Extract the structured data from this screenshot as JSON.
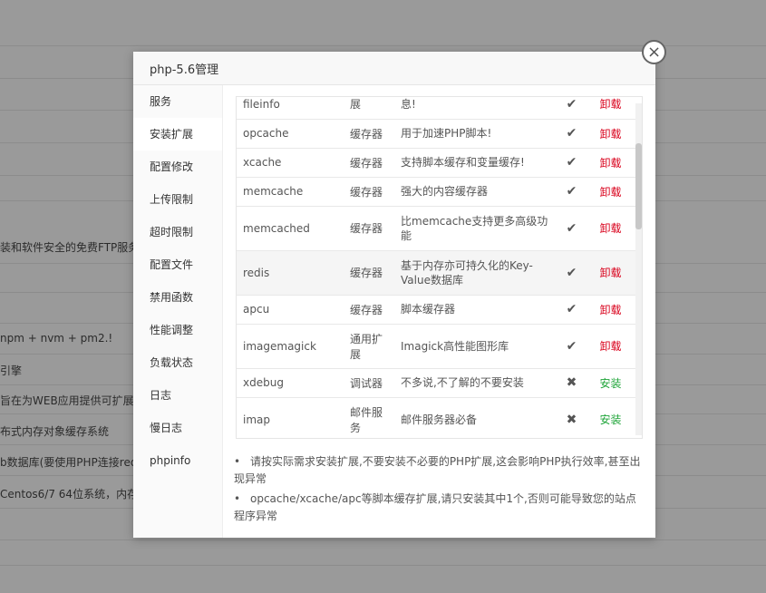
{
  "background": {
    "lines": [
      "装和软件安全的免费FTP服务器",
      "npm + nvm + pm2.!",
      "引擎",
      "旨在为WEB应用提供可扩展的",
      "布式内存对象缓存系统",
      "b数据库(要使用PHP连接redi",
      "Centos6/7 64位系统，内存"
    ]
  },
  "modal": {
    "title": "php-5.6管理",
    "close_icon": "×"
  },
  "sidebar": {
    "items": [
      {
        "label": "服务"
      },
      {
        "label": "安装扩展"
      },
      {
        "label": "配置修改"
      },
      {
        "label": "上传限制"
      },
      {
        "label": "超时限制"
      },
      {
        "label": "配置文件"
      },
      {
        "label": "禁用函数"
      },
      {
        "label": "性能调整"
      },
      {
        "label": "负载状态"
      },
      {
        "label": "日志"
      },
      {
        "label": "慢日志"
      },
      {
        "label": "phpinfo"
      }
    ]
  },
  "extensions": {
    "rows": [
      {
        "name": "fileinfo",
        "type": "展",
        "desc": "息!",
        "status": "✔",
        "action": "卸载"
      },
      {
        "name": "opcache",
        "type": "缓存器",
        "desc": "用于加速PHP脚本!",
        "status": "✔",
        "action": "卸载"
      },
      {
        "name": "xcache",
        "type": "缓存器",
        "desc": "支持脚本缓存和变量缓存!",
        "status": "✔",
        "action": "卸载"
      },
      {
        "name": "memcache",
        "type": "缓存器",
        "desc": "强大的内容缓存器",
        "status": "✔",
        "action": "卸载"
      },
      {
        "name": "memcached",
        "type": "缓存器",
        "desc": "比memcache支持更多高级功能",
        "status": "✔",
        "action": "卸载"
      },
      {
        "name": "redis",
        "type": "缓存器",
        "desc": "基于内存亦可持久化的Key-Value数据库",
        "status": "✔",
        "action": "卸载"
      },
      {
        "name": "apcu",
        "type": "缓存器",
        "desc": "脚本缓存器",
        "status": "✔",
        "action": "卸载"
      },
      {
        "name": "imagemagick",
        "type": "通用扩展",
        "desc": "Imagick高性能图形库",
        "status": "✔",
        "action": "卸载"
      },
      {
        "name": "xdebug",
        "type": "调试器",
        "desc": "不多说,不了解的不要安装",
        "status": "✖",
        "action": "安装"
      },
      {
        "name": "imap",
        "type": "邮件服务",
        "desc": "邮件服务器必备",
        "status": "✖",
        "action": "安装"
      }
    ]
  },
  "tips": [
    "请按实际需求安装扩展,不要安装不必要的PHP扩展,这会影响PHP执行效率,甚至出现异常",
    "opcache/xcache/apc等脚本缓存扩展,请只安装其中1个,否则可能导致您的站点程序异常"
  ],
  "colors": {
    "uninstall": "#d9001b",
    "install": "#20a53a"
  }
}
